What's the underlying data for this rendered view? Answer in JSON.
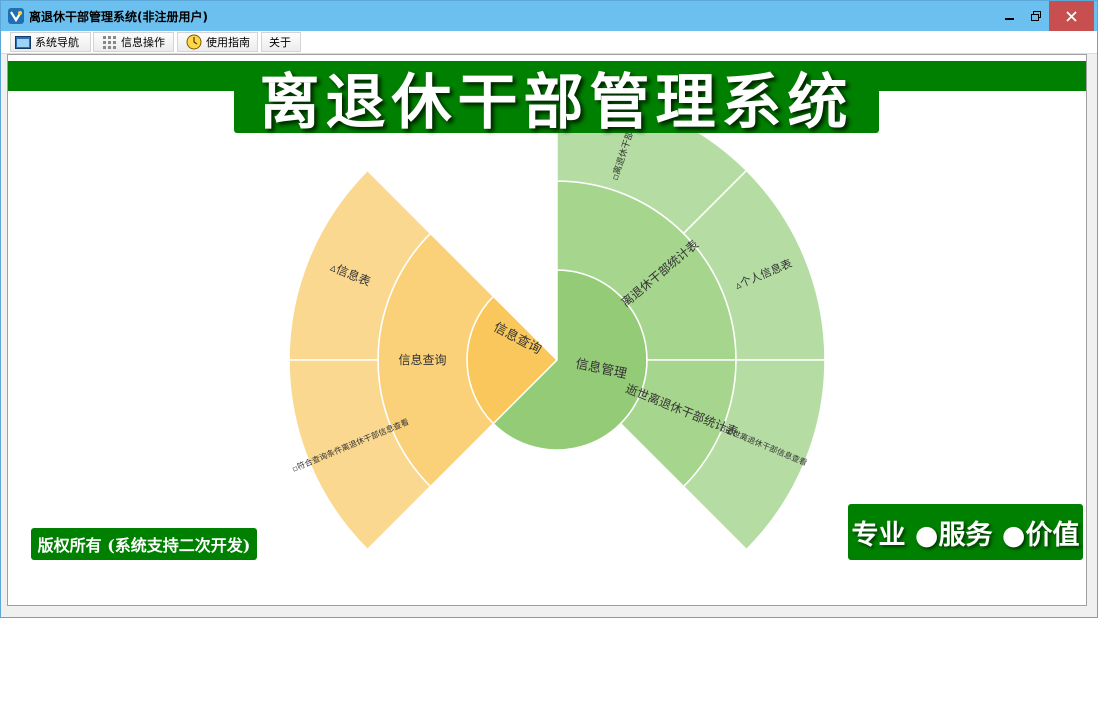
{
  "window": {
    "title": "离退休干部管理系统(非注册用户)"
  },
  "menu": [
    {
      "label": "系统导航",
      "icon": "window-icon"
    },
    {
      "label": "信息操作",
      "icon": "grid-icon"
    },
    {
      "label": "使用指南",
      "icon": "clock-icon"
    },
    {
      "label": "关于",
      "icon": ""
    }
  ],
  "banner": {
    "title": "离退休干部管理系统"
  },
  "footer": {
    "copyright": "版权所有 (系统支持二次开发)",
    "slogan": "专业 ●服务 ●价值"
  },
  "colors": {
    "titlebar": "#6cc0ef",
    "brand_green": "#008000",
    "close_button": "#c74f4f",
    "query_inner": "#f9c75b",
    "query_middle": "#fad178",
    "query_outer": "#fbd88f",
    "manage_inner": "#94cb77",
    "manage_middle": "#a6d58e",
    "manage_outer": "#b5dda3"
  },
  "chart_data": {
    "type": "sunburst",
    "nodes": [
      {
        "name": "信息查询",
        "children": [
          {
            "name": "信息查询",
            "children": [
              {
                "name": "▵信息表"
              },
              {
                "name": "▫符合查询条件离退休干部信息查看"
              }
            ]
          }
        ]
      },
      {
        "name": "信息管理",
        "children": [
          {
            "name": "离退休干部统计表",
            "children": [
              {
                "name": "▫离退休干部信息"
              },
              {
                "name": "▵个人信息表"
              }
            ]
          },
          {
            "name": "逝世离退休干部统计表",
            "children": [
              {
                "name": "▫逝世离退休干部信息查看"
              }
            ]
          }
        ]
      }
    ]
  }
}
